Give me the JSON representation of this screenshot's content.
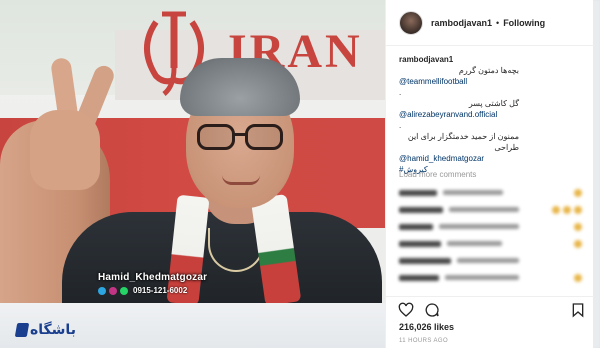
{
  "post": {
    "username": "rambodjavan1",
    "follow_status": "Following",
    "separator": "•",
    "caption": {
      "line1": "بچه‌ها دمتون گررم",
      "mention1": "@teammellifootball",
      "dot1": ".",
      "line2": "گل کاشتی پسر",
      "mention2": "@alirezabeyranvand.official",
      "dot2": ".",
      "line3": "ممنون از حمید خدمتگزار برای این طراحی",
      "mention3": "@hamid_khedmatgozar",
      "hashtag": "#کیروش"
    },
    "load_more": "Load more comments",
    "likes": "216,026 likes",
    "time_ago": "11 HOURS AGO"
  },
  "photo": {
    "flag_text": "IRAN",
    "watermark_name": "Hamid_Khedmatgozar",
    "watermark_phone": "0915-121-6002"
  },
  "site_logo": "باشگاه",
  "icons": {
    "heart": "heart-icon",
    "comment": "comment-icon",
    "bookmark": "bookmark-icon"
  },
  "colors": {
    "flag_red": "#c8453f",
    "flag_green": "#2e7d43",
    "link": "#003569",
    "logo": "#1a3f8f"
  }
}
